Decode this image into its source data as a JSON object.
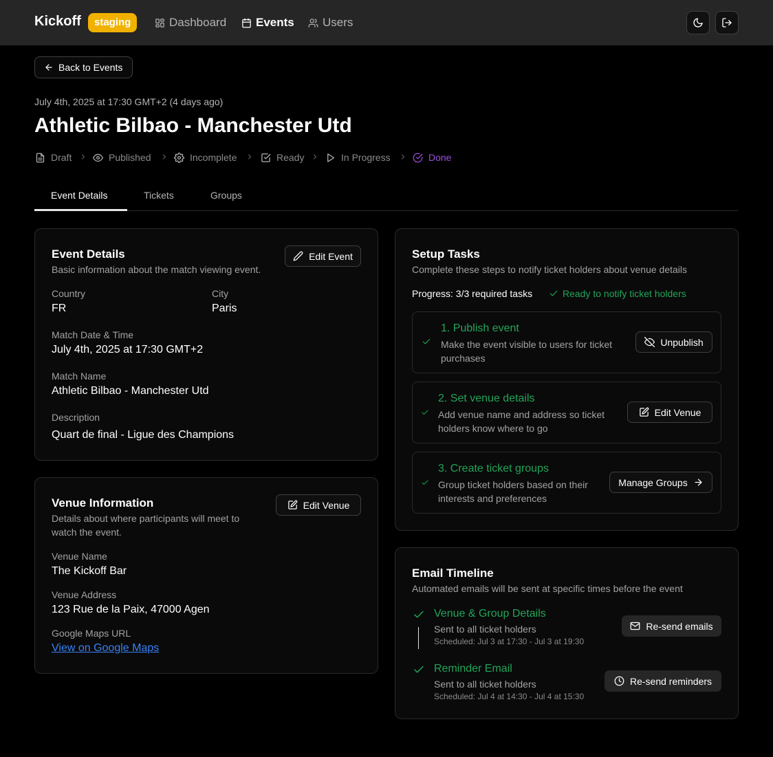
{
  "header": {
    "brand": "Kickoff",
    "env_badge": "staging",
    "nav": [
      {
        "label": "Dashboard",
        "icon": "dashboard-icon"
      },
      {
        "label": "Events",
        "icon": "calendar-icon"
      },
      {
        "label": "Users",
        "icon": "users-icon"
      }
    ]
  },
  "back_button": "Back to Events",
  "event": {
    "date": "July 4th, 2025 at 17:30 GMT+2 (4 days ago)",
    "title": "Athletic Bilbao - Manchester Utd"
  },
  "status_steps": [
    {
      "label": "Draft",
      "icon": "file-icon"
    },
    {
      "label": "Published",
      "icon": "eye-icon"
    },
    {
      "label": "Incomplete",
      "icon": "gear-icon"
    },
    {
      "label": "Ready",
      "icon": "checkbox-icon"
    },
    {
      "label": "In Progress",
      "icon": "play-icon"
    },
    {
      "label": "Done",
      "icon": "check-circle-icon",
      "active": true
    }
  ],
  "tabs": [
    "Event Details",
    "Tickets",
    "Groups"
  ],
  "event_details": {
    "title": "Event Details",
    "subtitle": "Basic information about the match viewing event.",
    "edit_button": "Edit Event",
    "country_label": "Country",
    "country": "FR",
    "city_label": "City",
    "city": "Paris",
    "datetime_label": "Match Date & Time",
    "datetime": "July 4th, 2025 at 17:30 GMT+2",
    "match_name_label": "Match Name",
    "match_name": "Athletic Bilbao - Manchester Utd",
    "description_label": "Description",
    "description": "Quart de final - Ligue des Champions"
  },
  "venue": {
    "title": "Venue Information",
    "subtitle": "Details about where participants will meet to watch the event.",
    "edit_button": "Edit Venue",
    "name_label": "Venue Name",
    "name": "The Kickoff Bar",
    "address_label": "Venue Address",
    "address": "123 Rue de la Paix, 47000 Agen",
    "maps_label": "Google Maps URL",
    "maps_link": "View on Google Maps"
  },
  "setup_tasks": {
    "title": "Setup Tasks",
    "subtitle": "Complete these steps to notify ticket holders about venue details",
    "progress": "Progress: 3/3 required tasks",
    "ready_text": "Ready to notify ticket holders",
    "tasks": [
      {
        "title": "1. Publish event",
        "desc": "Make the event visible to users for ticket purchases",
        "button": "Unpublish"
      },
      {
        "title": "2. Set venue details",
        "desc": "Add venue name and address so ticket holders know where to go",
        "button": "Edit Venue"
      },
      {
        "title": "3. Create ticket groups",
        "desc": "Group ticket holders based on their interests and preferences",
        "button": "Manage Groups"
      }
    ]
  },
  "email_timeline": {
    "title": "Email Timeline",
    "subtitle": "Automated emails will be sent at specific times before the event",
    "items": [
      {
        "title": "Venue & Group Details",
        "sub": "Sent to all ticket holders",
        "schedule": "Scheduled: Jul 3 at 17:30 - Jul 3 at 19:30",
        "button": "Re-send emails"
      },
      {
        "title": "Reminder Email",
        "sub": "Sent to all ticket holders",
        "schedule": "Scheduled: Jul 4 at 14:30 - Jul 4 at 15:30",
        "button": "Re-send reminders"
      }
    ]
  },
  "colors": {
    "background": "#000000",
    "header": "#262626",
    "badge": "#f0b100",
    "success": "#22a559",
    "done": "#9d4edd",
    "link": "#3b82f6"
  }
}
